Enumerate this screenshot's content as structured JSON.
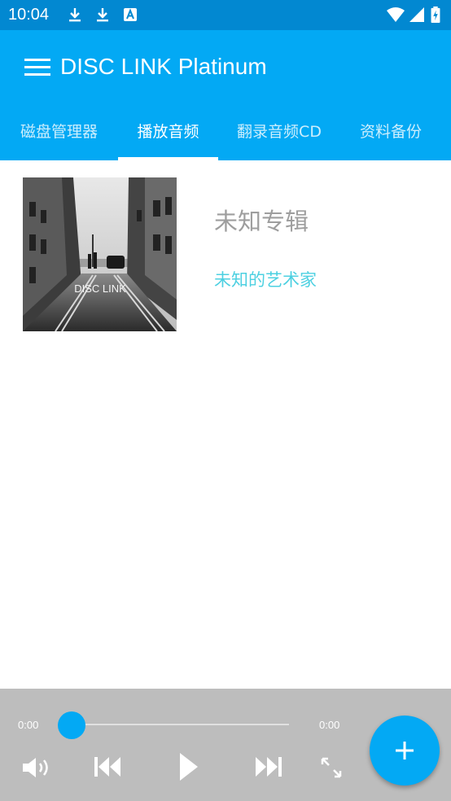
{
  "status_bar": {
    "time": "10:04",
    "icons": [
      "download-icon",
      "download-icon",
      "text-a-icon",
      "wifi-icon",
      "signal-icon",
      "battery-charging-icon"
    ]
  },
  "app_bar": {
    "title": "DISC LINK Platinum",
    "menu_icon": "hamburger-menu-icon"
  },
  "tabs": [
    {
      "label": "磁盘管理器",
      "active": false
    },
    {
      "label": "播放音频",
      "active": true
    },
    {
      "label": "翻录音频CD",
      "active": false
    },
    {
      "label": "资料备份",
      "active": false
    }
  ],
  "album": {
    "art_label": "DISC LINK",
    "title": "未知专辑",
    "artist": "未知的艺术家"
  },
  "player": {
    "elapsed": "0:00",
    "duration": "0:00",
    "progress": 0,
    "controls": [
      "volume-icon",
      "skip-previous-icon",
      "play-icon",
      "skip-next-icon",
      "fullscreen-icon"
    ]
  },
  "fab": {
    "icon": "add-icon"
  },
  "colors": {
    "status_bar": "#0288d1",
    "primary": "#03a9f4",
    "player_bg": "#bdbdbd",
    "artist_text": "#4dd0e1",
    "album_text": "#9e9e9e"
  }
}
